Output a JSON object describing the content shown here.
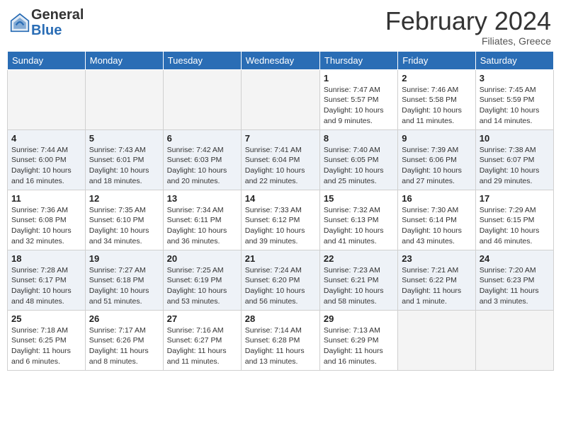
{
  "header": {
    "logo_general": "General",
    "logo_blue": "Blue",
    "month_year": "February 2024",
    "location": "Filiates, Greece"
  },
  "days_of_week": [
    "Sunday",
    "Monday",
    "Tuesday",
    "Wednesday",
    "Thursday",
    "Friday",
    "Saturday"
  ],
  "weeks": [
    [
      {
        "day": "",
        "info": ""
      },
      {
        "day": "",
        "info": ""
      },
      {
        "day": "",
        "info": ""
      },
      {
        "day": "",
        "info": ""
      },
      {
        "day": "1",
        "info": "Sunrise: 7:47 AM\nSunset: 5:57 PM\nDaylight: 10 hours\nand 9 minutes."
      },
      {
        "day": "2",
        "info": "Sunrise: 7:46 AM\nSunset: 5:58 PM\nDaylight: 10 hours\nand 11 minutes."
      },
      {
        "day": "3",
        "info": "Sunrise: 7:45 AM\nSunset: 5:59 PM\nDaylight: 10 hours\nand 14 minutes."
      }
    ],
    [
      {
        "day": "4",
        "info": "Sunrise: 7:44 AM\nSunset: 6:00 PM\nDaylight: 10 hours\nand 16 minutes."
      },
      {
        "day": "5",
        "info": "Sunrise: 7:43 AM\nSunset: 6:01 PM\nDaylight: 10 hours\nand 18 minutes."
      },
      {
        "day": "6",
        "info": "Sunrise: 7:42 AM\nSunset: 6:03 PM\nDaylight: 10 hours\nand 20 minutes."
      },
      {
        "day": "7",
        "info": "Sunrise: 7:41 AM\nSunset: 6:04 PM\nDaylight: 10 hours\nand 22 minutes."
      },
      {
        "day": "8",
        "info": "Sunrise: 7:40 AM\nSunset: 6:05 PM\nDaylight: 10 hours\nand 25 minutes."
      },
      {
        "day": "9",
        "info": "Sunrise: 7:39 AM\nSunset: 6:06 PM\nDaylight: 10 hours\nand 27 minutes."
      },
      {
        "day": "10",
        "info": "Sunrise: 7:38 AM\nSunset: 6:07 PM\nDaylight: 10 hours\nand 29 minutes."
      }
    ],
    [
      {
        "day": "11",
        "info": "Sunrise: 7:36 AM\nSunset: 6:08 PM\nDaylight: 10 hours\nand 32 minutes."
      },
      {
        "day": "12",
        "info": "Sunrise: 7:35 AM\nSunset: 6:10 PM\nDaylight: 10 hours\nand 34 minutes."
      },
      {
        "day": "13",
        "info": "Sunrise: 7:34 AM\nSunset: 6:11 PM\nDaylight: 10 hours\nand 36 minutes."
      },
      {
        "day": "14",
        "info": "Sunrise: 7:33 AM\nSunset: 6:12 PM\nDaylight: 10 hours\nand 39 minutes."
      },
      {
        "day": "15",
        "info": "Sunrise: 7:32 AM\nSunset: 6:13 PM\nDaylight: 10 hours\nand 41 minutes."
      },
      {
        "day": "16",
        "info": "Sunrise: 7:30 AM\nSunset: 6:14 PM\nDaylight: 10 hours\nand 43 minutes."
      },
      {
        "day": "17",
        "info": "Sunrise: 7:29 AM\nSunset: 6:15 PM\nDaylight: 10 hours\nand 46 minutes."
      }
    ],
    [
      {
        "day": "18",
        "info": "Sunrise: 7:28 AM\nSunset: 6:17 PM\nDaylight: 10 hours\nand 48 minutes."
      },
      {
        "day": "19",
        "info": "Sunrise: 7:27 AM\nSunset: 6:18 PM\nDaylight: 10 hours\nand 51 minutes."
      },
      {
        "day": "20",
        "info": "Sunrise: 7:25 AM\nSunset: 6:19 PM\nDaylight: 10 hours\nand 53 minutes."
      },
      {
        "day": "21",
        "info": "Sunrise: 7:24 AM\nSunset: 6:20 PM\nDaylight: 10 hours\nand 56 minutes."
      },
      {
        "day": "22",
        "info": "Sunrise: 7:23 AM\nSunset: 6:21 PM\nDaylight: 10 hours\nand 58 minutes."
      },
      {
        "day": "23",
        "info": "Sunrise: 7:21 AM\nSunset: 6:22 PM\nDaylight: 11 hours\nand 1 minute."
      },
      {
        "day": "24",
        "info": "Sunrise: 7:20 AM\nSunset: 6:23 PM\nDaylight: 11 hours\nand 3 minutes."
      }
    ],
    [
      {
        "day": "25",
        "info": "Sunrise: 7:18 AM\nSunset: 6:25 PM\nDaylight: 11 hours\nand 6 minutes."
      },
      {
        "day": "26",
        "info": "Sunrise: 7:17 AM\nSunset: 6:26 PM\nDaylight: 11 hours\nand 8 minutes."
      },
      {
        "day": "27",
        "info": "Sunrise: 7:16 AM\nSunset: 6:27 PM\nDaylight: 11 hours\nand 11 minutes."
      },
      {
        "day": "28",
        "info": "Sunrise: 7:14 AM\nSunset: 6:28 PM\nDaylight: 11 hours\nand 13 minutes."
      },
      {
        "day": "29",
        "info": "Sunrise: 7:13 AM\nSunset: 6:29 PM\nDaylight: 11 hours\nand 16 minutes."
      },
      {
        "day": "",
        "info": ""
      },
      {
        "day": "",
        "info": ""
      }
    ]
  ]
}
